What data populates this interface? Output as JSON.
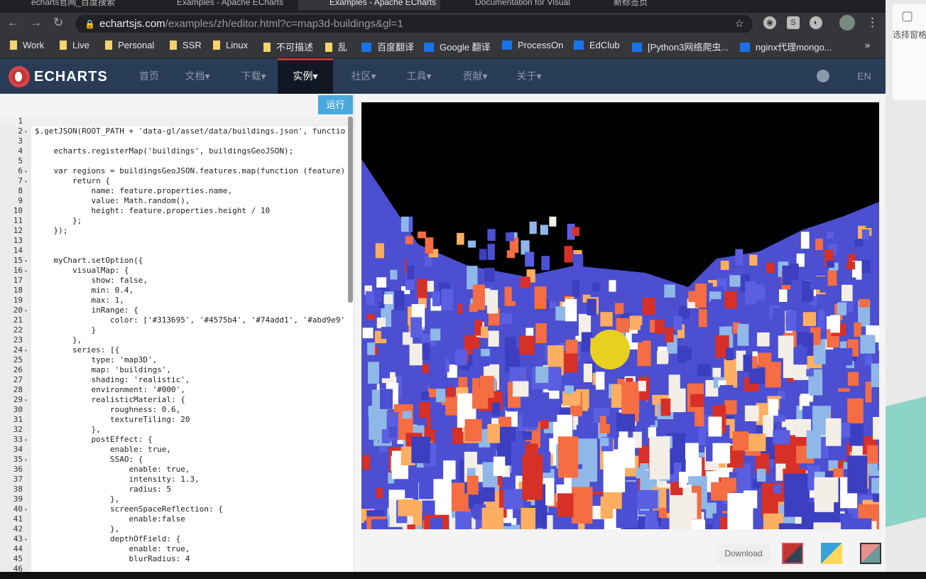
{
  "browser": {
    "tabs": [
      {
        "label": "echarts官网_百度搜索"
      },
      {
        "label": "Examples - Apache ECharts"
      },
      {
        "label": "Examples - Apache ECharts",
        "active": true
      },
      {
        "label": "Documentation for Visual"
      },
      {
        "label": "新标签页"
      }
    ],
    "url_host": "echartsjs.com",
    "url_path": "/examples/zh/editor.html?c=map3d-buildings&gl=1",
    "bookmarks": [
      "Work",
      "Live",
      "Personal",
      "SSR",
      "Linux",
      "不可描述",
      "乱",
      "百度翻译",
      "Google 翻译",
      "ProcessOn",
      "EdClub",
      "[Python3网络爬虫...",
      "nginx代理mongo..."
    ],
    "more": "»"
  },
  "nav": {
    "logo": "ECHARTS",
    "items": [
      {
        "label": "首页"
      },
      {
        "label": "文档▾"
      },
      {
        "label": "下载▾"
      },
      {
        "label": "实例▾",
        "active": true
      },
      {
        "label": "社区▾"
      },
      {
        "label": "工具▾"
      },
      {
        "label": "贡献▾"
      },
      {
        "label": "关于▾"
      }
    ],
    "lang": "EN"
  },
  "editor": {
    "run_label": "运行",
    "folded_lines": [
      2,
      6,
      7,
      15,
      16,
      20,
      24,
      29,
      33,
      35,
      40,
      43
    ],
    "lines": [
      "",
      "$.getJSON(ROOT_PATH + 'data-gl/asset/data/buildings.json', functio",
      "",
      "    echarts.registerMap('buildings', buildingsGeoJSON);",
      "",
      "    var regions = buildingsGeoJSON.features.map(function (feature)",
      "        return {",
      "            name: feature.properties.name,",
      "            value: Math.random(),",
      "            height: feature.properties.height / 10",
      "        };",
      "    });",
      "",
      "",
      "    myChart.setOption({",
      "        visualMap: {",
      "            show: false,",
      "            min: 0.4,",
      "            max: 1,",
      "            inRange: {",
      "                color: ['#313695', '#4575b4', '#74add1', '#abd9e9'",
      "            }",
      "        },",
      "        series: [{",
      "            type: 'map3D',",
      "            map: 'buildings',",
      "            shading: 'realistic',",
      "            environment: '#000',",
      "            realisticMaterial: {",
      "                roughness: 0.6,",
      "                textureTiling: 20",
      "            },",
      "            postEffect: {",
      "                enable: true,",
      "                SSAO: {",
      "                    enable: true,",
      "                    intensity: 1.3,",
      "                    radius: 5",
      "                },",
      "                screenSpaceReflection: {",
      "                    enable:false",
      "                },",
      "                depthOfField: {",
      "                    enable: true,",
      "                    blurRadius: 4",
      ""
    ]
  },
  "chart": {
    "download_label": "Download",
    "palette": [
      "#313695",
      "#4575b4",
      "#74add1",
      "#abd9e9",
      "#f4f4f4",
      "#f46d43",
      "#d73027",
      "#fdae61"
    ],
    "themes": [
      {
        "name": "default",
        "colors": [
          "#c23531",
          "#2f4554"
        ]
      },
      {
        "name": "light",
        "colors": [
          "#37a2da",
          "#ffd85c"
        ]
      },
      {
        "name": "dark",
        "colors": [
          "#e98f8f",
          "#6e9a9a"
        ]
      }
    ]
  },
  "side": {
    "label": "选择窗格"
  }
}
